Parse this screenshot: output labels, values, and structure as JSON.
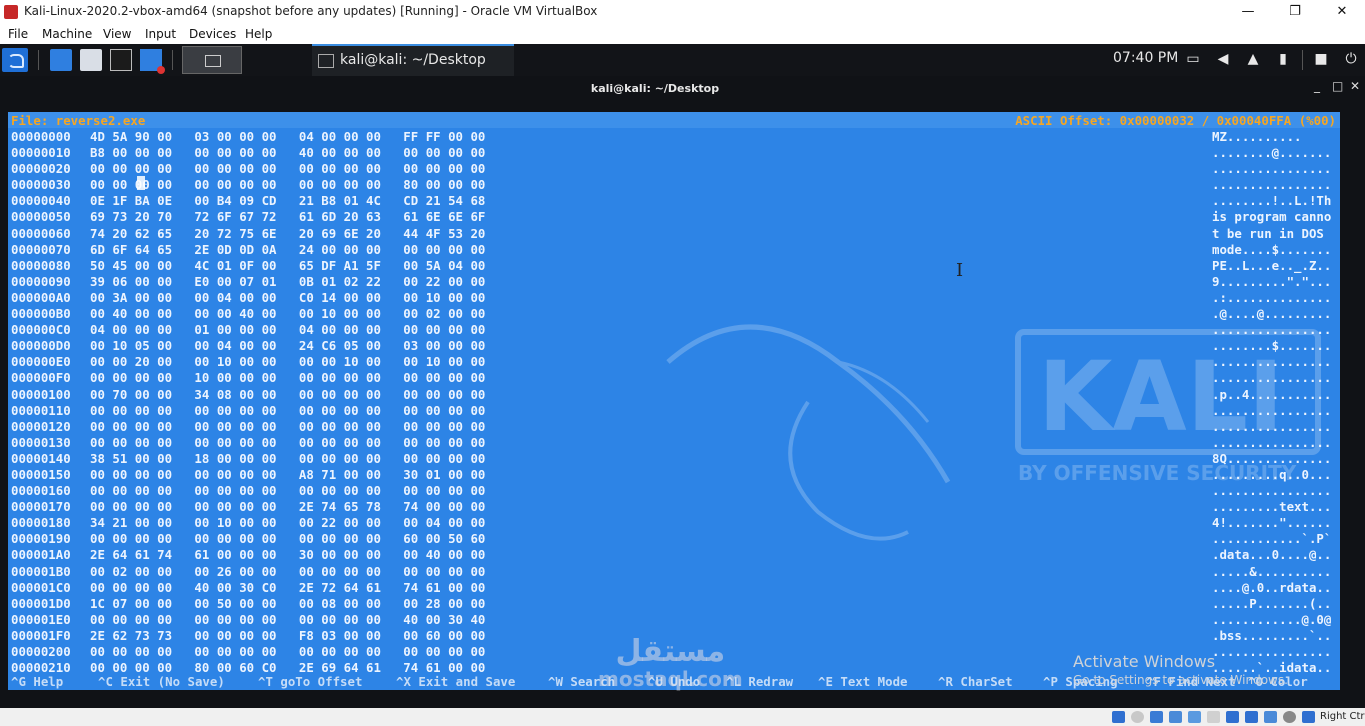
{
  "window": {
    "title": "Kali-Linux-2020.2-vbox-amd64 (snapshot before any updates) [Running] - Oracle VM VirtualBox",
    "controls": [
      "—",
      "❐",
      "✕"
    ]
  },
  "menu": [
    "File",
    "Machine",
    "View",
    "Input",
    "Devices",
    "Help"
  ],
  "panel": {
    "task_title": "kali@kali: ~/Desktop",
    "clock": "07:40 PM"
  },
  "terminal": {
    "title": "kali@kali: ~/Desktop",
    "controls": [
      "_",
      "□",
      "✕"
    ]
  },
  "hexeditor": {
    "file_label": "File: reverse2.exe",
    "offset_label": "ASCII Offset: 0x00000032 / 0x00040FFA (%00)",
    "rows": [
      {
        "off": "00000000",
        "hex": "4D 5A 90 00   03 00 00 00   04 00 00 00   FF FF 00 00",
        "ascii": "MZ.........."
      },
      {
        "off": "00000010",
        "hex": "B8 00 00 00   00 00 00 00   40 00 00 00   00 00 00 00",
        "ascii": "........@......."
      },
      {
        "off": "00000020",
        "hex": "00 00 00 00   00 00 00 00   00 00 00 00   00 00 00 00",
        "ascii": "................"
      },
      {
        "off": "00000030",
        "hex": "00 00 00 00   00 00 00 00   00 00 00 00   80 00 00 00",
        "ascii": "................"
      },
      {
        "off": "00000040",
        "hex": "0E 1F BA 0E   00 B4 09 CD   21 B8 01 4C   CD 21 54 68",
        "ascii": "........!..L.!Th"
      },
      {
        "off": "00000050",
        "hex": "69 73 20 70   72 6F 67 72   61 6D 20 63   61 6E 6E 6F",
        "ascii": "is program canno"
      },
      {
        "off": "00000060",
        "hex": "74 20 62 65   20 72 75 6E   20 69 6E 20   44 4F 53 20",
        "ascii": "t be run in DOS "
      },
      {
        "off": "00000070",
        "hex": "6D 6F 64 65   2E 0D 0D 0A   24 00 00 00   00 00 00 00",
        "ascii": "mode....$......."
      },
      {
        "off": "00000080",
        "hex": "50 45 00 00   4C 01 0F 00   65 DF A1 5F   00 5A 04 00",
        "ascii": "PE..L...e.._.Z.."
      },
      {
        "off": "00000090",
        "hex": "39 06 00 00   E0 00 07 01   0B 01 02 22   00 22 00 00",
        "ascii": "9.........\".\"..."
      },
      {
        "off": "000000A0",
        "hex": "00 3A 00 00   00 04 00 00   C0 14 00 00   00 10 00 00",
        "ascii": ".:.............."
      },
      {
        "off": "000000B0",
        "hex": "00 40 00 00   00 00 40 00   00 10 00 00   00 02 00 00",
        "ascii": ".@....@........."
      },
      {
        "off": "000000C0",
        "hex": "04 00 00 00   01 00 00 00   04 00 00 00   00 00 00 00",
        "ascii": "................"
      },
      {
        "off": "000000D0",
        "hex": "00 10 05 00   00 04 00 00   24 C6 05 00   03 00 00 00",
        "ascii": "........$......."
      },
      {
        "off": "000000E0",
        "hex": "00 00 20 00   00 10 00 00   00 00 10 00   00 10 00 00",
        "ascii": "................"
      },
      {
        "off": "000000F0",
        "hex": "00 00 00 00   10 00 00 00   00 00 00 00   00 00 00 00",
        "ascii": "................"
      },
      {
        "off": "00000100",
        "hex": "00 70 00 00   34 08 00 00   00 00 00 00   00 00 00 00",
        "ascii": ".p..4..........."
      },
      {
        "off": "00000110",
        "hex": "00 00 00 00   00 00 00 00   00 00 00 00   00 00 00 00",
        "ascii": "................"
      },
      {
        "off": "00000120",
        "hex": "00 00 00 00   00 00 00 00   00 00 00 00   00 00 00 00",
        "ascii": "................"
      },
      {
        "off": "00000130",
        "hex": "00 00 00 00   00 00 00 00   00 00 00 00   00 00 00 00",
        "ascii": "................"
      },
      {
        "off": "00000140",
        "hex": "38 51 00 00   18 00 00 00   00 00 00 00   00 00 00 00",
        "ascii": "8Q.............."
      },
      {
        "off": "00000150",
        "hex": "00 00 00 00   00 00 00 00   A8 71 00 00   30 01 00 00",
        "ascii": ".........q..0..."
      },
      {
        "off": "00000160",
        "hex": "00 00 00 00   00 00 00 00   00 00 00 00   00 00 00 00",
        "ascii": "................"
      },
      {
        "off": "00000170",
        "hex": "00 00 00 00   00 00 00 00   2E 74 65 78   74 00 00 00",
        "ascii": ".........text..."
      },
      {
        "off": "00000180",
        "hex": "34 21 00 00   00 10 00 00   00 22 00 00   00 04 00 00",
        "ascii": "4!.......\"......"
      },
      {
        "off": "00000190",
        "hex": "00 00 00 00   00 00 00 00   00 00 00 00   60 00 50 60",
        "ascii": "............`.P`"
      },
      {
        "off": "000001A0",
        "hex": "2E 64 61 74   61 00 00 00   30 00 00 00   00 40 00 00",
        "ascii": ".data...0....@.."
      },
      {
        "off": "000001B0",
        "hex": "00 02 00 00   00 26 00 00   00 00 00 00   00 00 00 00",
        "ascii": ".....&.........."
      },
      {
        "off": "000001C0",
        "hex": "00 00 00 00   40 00 30 C0   2E 72 64 61   74 61 00 00",
        "ascii": "....@.0..rdata.."
      },
      {
        "off": "000001D0",
        "hex": "1C 07 00 00   00 50 00 00   00 08 00 00   00 28 00 00",
        "ascii": ".....P.......(.."
      },
      {
        "off": "000001E0",
        "hex": "00 00 00 00   00 00 00 00   00 00 00 00   40 00 30 40",
        "ascii": "............@.0@"
      },
      {
        "off": "000001F0",
        "hex": "2E 62 73 73   00 00 00 00   F8 03 00 00   00 60 00 00",
        "ascii": ".bss.........`.."
      },
      {
        "off": "00000200",
        "hex": "00 00 00 00   00 00 00 00   00 00 00 00   00 00 00 00",
        "ascii": "................"
      },
      {
        "off": "00000210",
        "hex": "00 00 00 00   80 00 60 C0   2E 69 64 61   74 61 00 00",
        "ascii": "......`..idata.."
      }
    ],
    "helpbar": [
      "^G Help",
      "^C Exit (No Save)",
      "^T goTo Offset",
      "^X Exit and Save",
      "^W Search",
      "^U Undo",
      "^L Redraw",
      "^E Text Mode",
      "^R CharSet",
      "^P Spacing",
      "^F Find Next",
      "^O Color"
    ]
  },
  "overlay": {
    "activate_title": "Activate Windows",
    "activate_sub": "Go to Settings to activate Windows.",
    "mostaql_ar": "مستقل",
    "mostaql_url": "mostaql.com"
  },
  "statusbar": {
    "host_key": "Right Ctrl"
  },
  "colors": {
    "hex_background": "#2d84e6",
    "header_text": "#f5a623",
    "panel": "#121418"
  }
}
